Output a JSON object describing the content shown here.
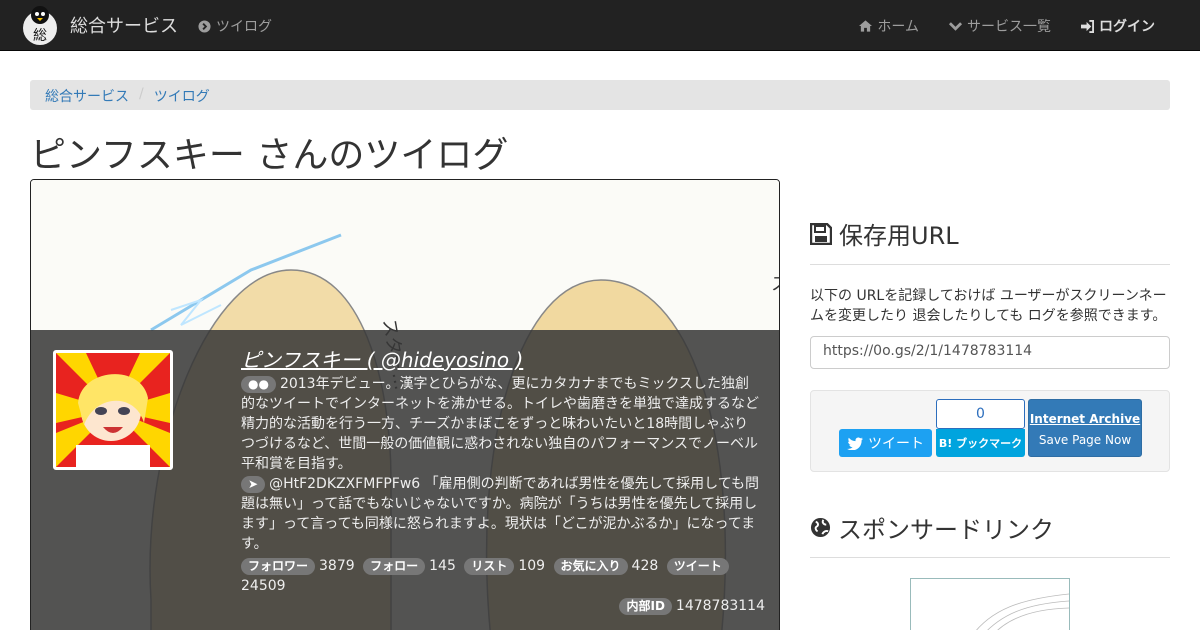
{
  "navbar": {
    "brand": "総合サービス",
    "logo_char": "総",
    "app_link": "ツイログ",
    "home": "ホーム",
    "services": "サービス一覧",
    "login": "ログイン"
  },
  "breadcrumb": [
    "総合サービス",
    "ツイログ"
  ],
  "page_title": "ピンフスキー さんのツイログ",
  "profile": {
    "name": "ピンフスキー ( @hideyosino )",
    "bio": "2013年デビュー。漢字とひらがな、更にカタカナまでもミックスした独創的なツイートでインターネットを沸かせる。トイレや歯磨きを単独で達成するなど精力的な活動を行う一方、チーズかまぼこをずっと味わいたいと18時間しゃぶりつづけるなど、世間一般の価値観に惑わされない独自のパフォーマンスでノーベル平和賞を目指す。",
    "latest_tweet": "@HtF2DKZXFMFPFw6 「雇用側の判断であれば男性を優先して採用しても問題は無い」って話でもないじゃないですか。病院が「うちは男性を優先して採用します」って言っても同様に怒られますよ。現状は「どこが泥かぶるか」になってます。",
    "stats": [
      {
        "label": "フォロワー",
        "value": "3879"
      },
      {
        "label": "フォロー",
        "value": "145"
      },
      {
        "label": "リスト",
        "value": "109"
      },
      {
        "label": "お気に入り",
        "value": "428"
      },
      {
        "label": "ツイート",
        "value": "24509"
      }
    ],
    "internal_id_label": "内部ID",
    "internal_id": "1478783114"
  },
  "save_url": {
    "heading": "保存用URL",
    "description": "以下の URLを記録しておけば ユーザーがスクリーンネームを変更したり 退会したりしても ログを参照できます。",
    "url": "https://0o.gs/2/1/1478783114"
  },
  "share": {
    "tweet_label": "ツイート",
    "hatena_count": "0",
    "hatena_label": "B! ブックマーク",
    "ia_title": "Internet Archive",
    "ia_action": "Save Page Now"
  },
  "sponsor": {
    "heading": "スポンサードリンク"
  },
  "colors": {
    "navbar": "#222222",
    "link": "#337ab7",
    "twitter": "#1da1f2",
    "hatena": "#00a4de"
  }
}
